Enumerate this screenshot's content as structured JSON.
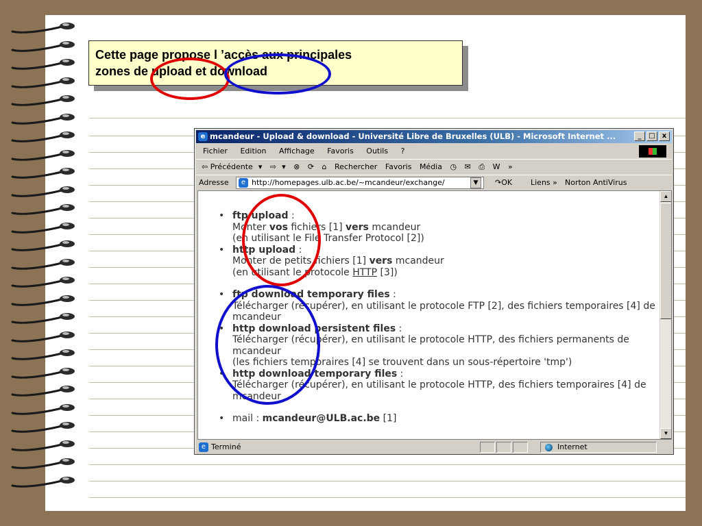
{
  "slide": {
    "callout_line1": "Cette page propose l ’accès aux principales",
    "callout_line2": "zones de upload et download"
  },
  "browser": {
    "title": "mcandeur - Upload & download - Université Libre de Bruxelles (ULB) - Microsoft Internet ...",
    "window_buttons": [
      "_",
      "□",
      "x"
    ],
    "menu": [
      "Fichier",
      "Edition",
      "Affichage",
      "Favoris",
      "Outils",
      "?"
    ],
    "toolbar": {
      "back": "⇦ Précédente",
      "back_arrow": "▾",
      "forward": "⇨",
      "forward_arrow": "▾",
      "stop_icon": "⊗",
      "refresh_icon": "⟳",
      "home_icon": "⌂",
      "search": "Rechercher",
      "favorites": "Favoris",
      "media": "Média",
      "history_icon": "◷",
      "mail_icon": "✉",
      "print_icon": "⎙",
      "edit_icon": "W",
      "more": "»"
    },
    "address": {
      "label": "Adresse",
      "url": "http://homepages.ulb.ac.be/~mcandeur/exchange/",
      "go": "↷OK",
      "links": "Liens »",
      "norton": "Norton AntiVirus"
    },
    "status": {
      "text": "Terminé",
      "zone": "Internet"
    }
  },
  "content": {
    "ftp_upload": {
      "head": "ftp upload",
      "colon": " :",
      "line1_a": "Monter ",
      "line1_b": "vos",
      "line1_c": " fichiers [1] ",
      "line1_d": "vers",
      "line1_e": " mcandeur",
      "line2": "(en utilisant le File Transfer Protocol [2])"
    },
    "http_upload": {
      "head": "http upload",
      "colon": " :",
      "line1_a": "Monter de petits fichiers [1] ",
      "line1_b": "vers",
      "line1_c": " mcandeur",
      "line2_a": "(en utilisant le protocole ",
      "line2_b": "HTTP",
      "line2_c": " [3])"
    },
    "ftp_download_temp": {
      "head": "ftp download temporary files",
      "colon": " :",
      "line1": "Télécharger (récupérer), en utilisant le protocole FTP [2], des fichiers temporaires [4] de mcandeur"
    },
    "http_download_persistent": {
      "head": "http download persistent files",
      "colon": " :",
      "line1": "Télécharger (récupérer), en utilisant le protocole HTTP, des fichiers permanents de mcandeur",
      "line2": "(les fichiers temporaires [4] se trouvent dans un sous-répertoire 'tmp')"
    },
    "http_download_temp": {
      "head": "http download temporary files",
      "colon": " :",
      "line1": "Télécharger (récupérer), en utilisant le protocole HTTP, des fichiers temporaires [4] de mcandeur"
    },
    "mail": {
      "label": "mail : ",
      "address": "mcandeur@ULB.ac.be",
      "ref": " [1]"
    }
  }
}
